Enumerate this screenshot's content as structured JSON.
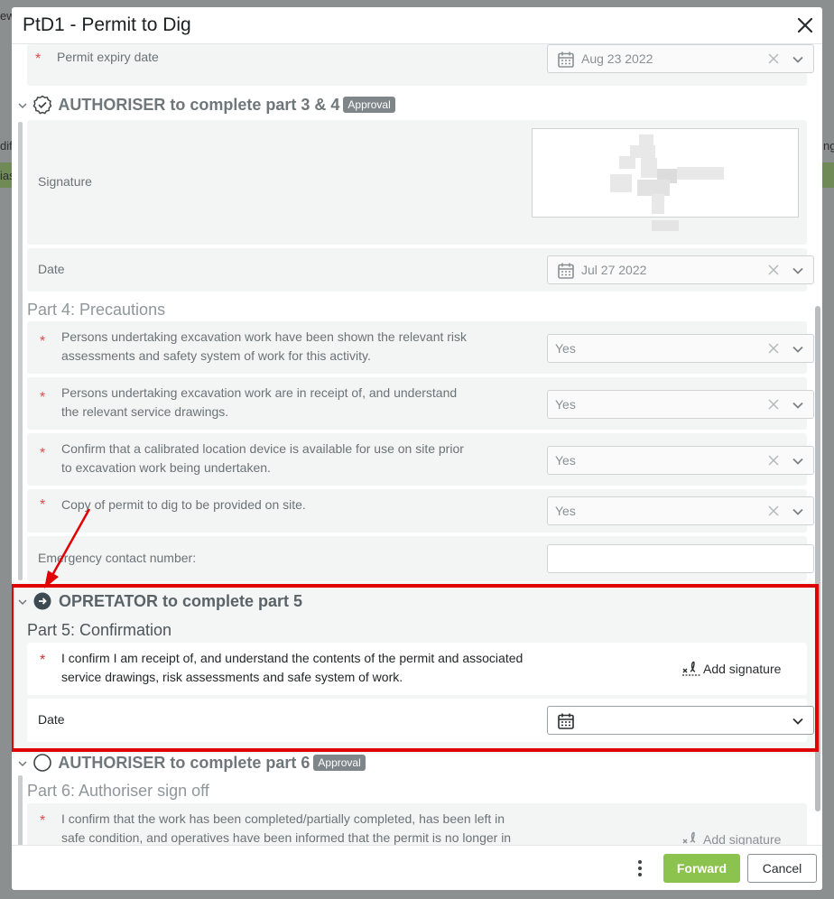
{
  "modal": {
    "title": "PtD1 - Permit to Dig"
  },
  "background": {
    "frag_top": "ew",
    "frag_left1": "dif",
    "frag_left2": "ias",
    "frag_right": "ng"
  },
  "expiry": {
    "label": "Permit expiry date",
    "value": "Aug 23 2022"
  },
  "authoriser34": {
    "heading": "AUTHORISER to complete part 3 & 4",
    "badge": "Approval",
    "signature_label": "Signature",
    "date_label": "Date",
    "date_value": "Jul 27 2022"
  },
  "part4": {
    "title": "Part 4: Precautions",
    "items": [
      {
        "text_l1": "Persons undertaking excavation work have been shown the relevant risk",
        "text_l2": "assessments and safety system of work for this activity.",
        "value": "Yes"
      },
      {
        "text_l1": "Persons undertaking excavation work are in receipt of, and understand",
        "text_l2": "the relevant service drawings.",
        "value": "Yes"
      },
      {
        "text_l1": "Confirm that a calibrated location device is available for use on site prior",
        "text_l2": "to excavation work being undertaken.",
        "value": "Yes"
      },
      {
        "text_l1": "Copy of permit to dig to be provided on site.",
        "text_l2": "",
        "value": "Yes"
      }
    ],
    "emergency_label": "Emergency contact number:",
    "emergency_value": ""
  },
  "operator5": {
    "heading": "OPRETATOR to complete part 5",
    "part_title": "Part 5: Confirmation",
    "confirm_l1": "I confirm I am receipt of, and understand the contents of the permit and associated",
    "confirm_l2": "service drawings, risk assessments and safe system of work.",
    "add_signature": "Add signature",
    "date_label": "Date"
  },
  "authoriser6": {
    "heading": "AUTHORISER to complete part 6",
    "badge": "Approval",
    "part_title": "Part 6: Authoriser sign off",
    "confirm_l1": "I confirm that the work has been completed/partially completed, has been left in",
    "confirm_l2": "safe condition, and operatives have been informed that the permit is no longer in",
    "add_signature": "Add signature"
  },
  "footer": {
    "forward": "Forward",
    "cancel": "Cancel"
  },
  "colors": {
    "accent_green": "#8cc34f",
    "highlight_red": "#e10000",
    "required": "#e04a4a"
  }
}
